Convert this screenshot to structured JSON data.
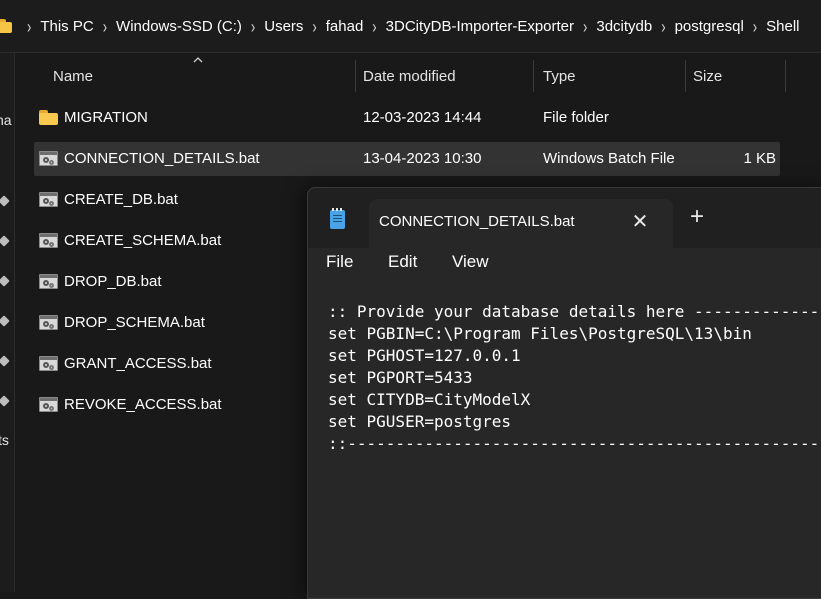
{
  "breadcrumb": {
    "items": [
      "This PC",
      "Windows-SSD (C:)",
      "Users",
      "fahad",
      "3DCityDB-Importer-Exporter",
      "3dcitydb",
      "postgresql",
      "Shell"
    ],
    "separator": "›"
  },
  "left_nav": {
    "partial_labels": [
      "na",
      "ts"
    ]
  },
  "columns": {
    "name": "Name",
    "date_modified": "Date modified",
    "type": "Type",
    "size": "Size"
  },
  "files": [
    {
      "name": "MIGRATION",
      "date": "12-03-2023 14:44",
      "type": "File folder",
      "size": "",
      "icon": "folder-icon",
      "selected": false
    },
    {
      "name": "CONNECTION_DETAILS.bat",
      "date": "13-04-2023 10:30",
      "type": "Windows Batch File",
      "size": "1 KB",
      "icon": "batch-file-icon",
      "selected": true
    },
    {
      "name": "CREATE_DB.bat",
      "icon": "batch-file-icon"
    },
    {
      "name": "CREATE_SCHEMA.bat",
      "icon": "batch-file-icon"
    },
    {
      "name": "DROP_DB.bat",
      "icon": "batch-file-icon"
    },
    {
      "name": "DROP_SCHEMA.bat",
      "icon": "batch-file-icon"
    },
    {
      "name": "GRANT_ACCESS.bat",
      "icon": "batch-file-icon"
    },
    {
      "name": "REVOKE_ACCESS.bat",
      "icon": "batch-file-icon"
    }
  ],
  "notepad": {
    "tab_title": "CONNECTION_DETAILS.bat",
    "close_glyph": "✕",
    "new_tab_glyph": "+",
    "menu": [
      "File",
      "Edit",
      "View"
    ],
    "content_lines": [
      ":: Provide your database details here -------------------------------------------",
      "set PGBIN=C:\\Program Files\\PostgreSQL\\13\\bin",
      "set PGHOST=127.0.0.1",
      "set PGPORT=5433",
      "set CITYDB=CityModelX",
      "set PGUSER=postgres",
      "::---------------------------------------------------------------------------------"
    ]
  },
  "colors": {
    "background": "#191919",
    "selected_row": "#333333",
    "folder": "#f8c84f",
    "notepad_icon": "#4aa3e6"
  }
}
